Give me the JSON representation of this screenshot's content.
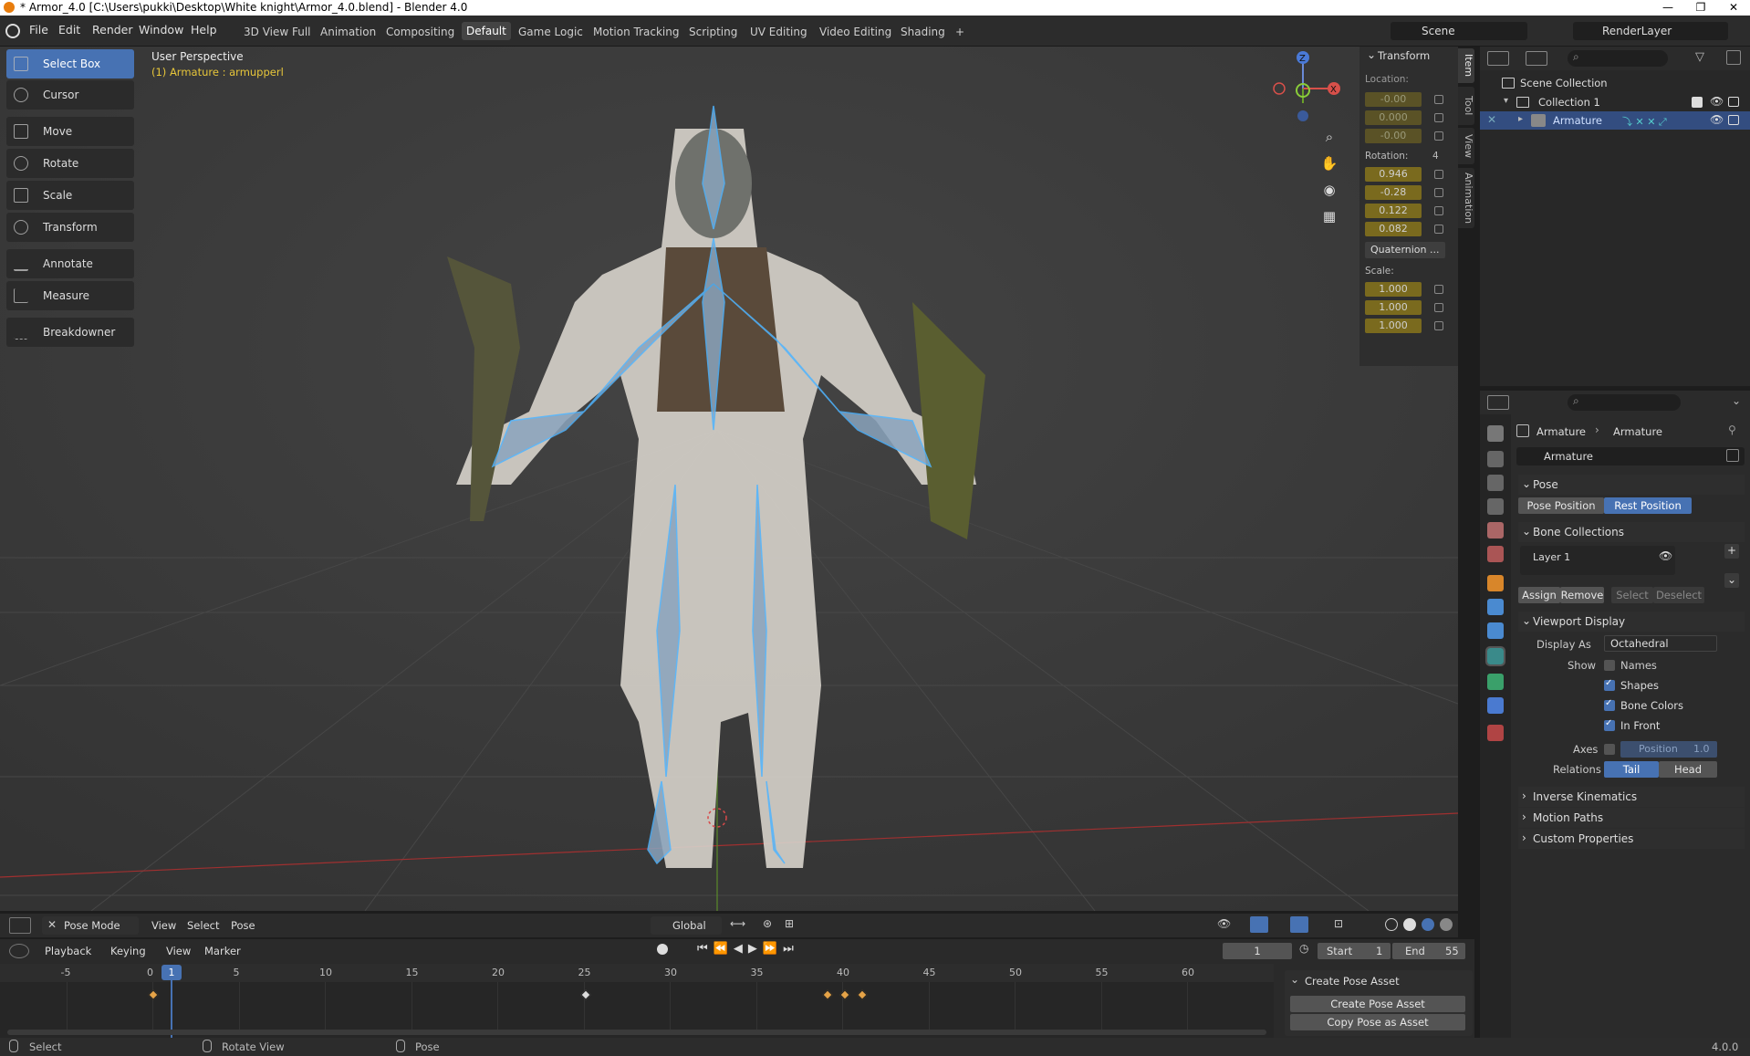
{
  "window": {
    "title": "* Armor_4.0 [C:\\Users\\pukki\\Desktop\\White knight\\Armor_4.0.blend] - Blender 4.0"
  },
  "menu": [
    "File",
    "Edit",
    "Render",
    "Window",
    "Help"
  ],
  "workspaces": [
    "3D View Full",
    "Animation",
    "Compositing",
    "Default",
    "Game Logic",
    "Motion Tracking",
    "Scripting",
    "UV Editing",
    "Video Editing",
    "Shading",
    "+"
  ],
  "scene": {
    "name": "Scene",
    "layer": "RenderLayer"
  },
  "viewport": {
    "perspective": "User Perspective",
    "object_info": "(1) Armature : armupperl"
  },
  "tools": [
    "Select Box",
    "Cursor",
    "Move",
    "Rotate",
    "Scale",
    "Transform",
    "Annotate",
    "Measure",
    "Breakdowner"
  ],
  "npanel": {
    "title": "Transform",
    "location_label": "Location:",
    "location": [
      "-0.00",
      "0.000",
      "-0.00"
    ],
    "rotation_label": "Rotation:",
    "rotation_mode_num": "4",
    "rotation": [
      "0.946",
      "-0.28",
      "0.122",
      "0.082"
    ],
    "rotation_mode": "Quaternion ...",
    "scale_label": "Scale:",
    "scale": [
      "1.000",
      "1.000",
      "1.000"
    ]
  },
  "side_tabs": [
    "Item",
    "Tool",
    "View",
    "Animation"
  ],
  "outliner": {
    "root": "Scene Collection",
    "collection": "Collection 1",
    "armature": "Armature"
  },
  "properties": {
    "breadcrumb_a": "Armature",
    "breadcrumb_b": "Armature",
    "data_name": "Armature",
    "pose_section": "Pose",
    "pose_position": "Pose Position",
    "rest_position": "Rest Position",
    "bone_collections": "Bone Collections",
    "layer": "Layer 1",
    "assign": "Assign",
    "remove": "Remove",
    "select": "Select",
    "deselect": "Deselect",
    "viewport_display": "Viewport Display",
    "display_as_label": "Display As",
    "display_as": "Octahedral",
    "show_label": "Show",
    "names": "Names",
    "shapes": "Shapes",
    "bone_colors": "Bone Colors",
    "in_front": "In Front",
    "axes_label": "Axes",
    "axes_position": "Position",
    "axes_value": "1.0",
    "relations_label": "Relations",
    "tail": "Tail",
    "head": "Head",
    "inverse_kinematics": "Inverse Kinematics",
    "motion_paths": "Motion Paths",
    "custom_properties": "Custom Properties"
  },
  "vheader": {
    "mode": "Pose Mode",
    "menus": [
      "View",
      "Select",
      "Pose"
    ],
    "orientation": "Global"
  },
  "timeline": {
    "menus": [
      "Playback",
      "Keying",
      "View",
      "Marker"
    ],
    "current_frame": "1",
    "start_label": "Start",
    "start": "1",
    "end_label": "End",
    "end": "55",
    "ticks": [
      "-5",
      "0",
      "1",
      "5",
      "10",
      "15",
      "20",
      "25",
      "30",
      "35",
      "40",
      "45",
      "50",
      "55",
      "60"
    ],
    "create_pose_title": "Create Pose Asset",
    "create_pose_btn": "Create Pose Asset",
    "copy_pose_btn": "Copy Pose as Asset"
  },
  "status": {
    "select": "Select",
    "rotate": "Rotate View",
    "pose": "Pose",
    "version": "4.0.0"
  }
}
